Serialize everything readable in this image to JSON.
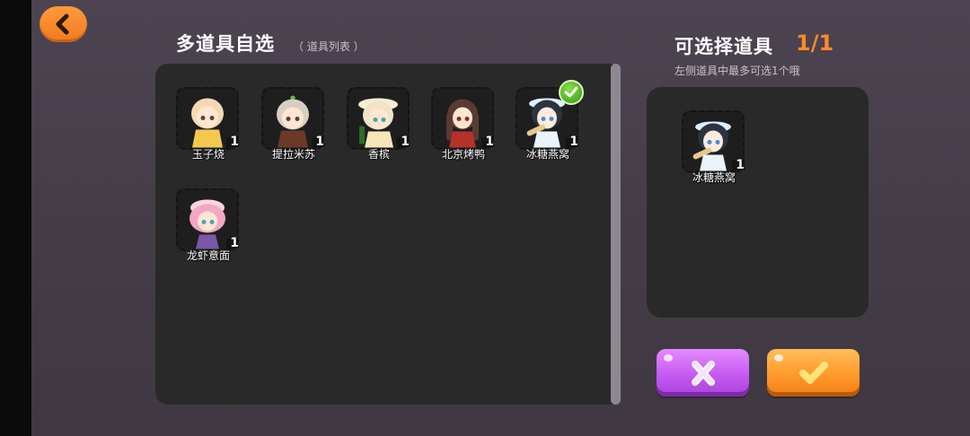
{
  "header": {
    "left_title": "多道具自选",
    "left_subtitle": "（ 道具列表 ）",
    "right_title": "可选择道具",
    "right_count": "1/1",
    "right_hint": "左侧道具中最多可选1个哦"
  },
  "items": [
    {
      "name": "玉子烧",
      "count": "1",
      "selected": false,
      "palette": {
        "hair": "#f3d9b3",
        "cloth": "#f2c94c"
      }
    },
    {
      "name": "提拉米苏",
      "count": "1",
      "selected": false,
      "palette": {
        "hair": "#d8cfc0",
        "cloth": "#6b3a28"
      }
    },
    {
      "name": "香槟",
      "count": "1",
      "selected": false,
      "palette": {
        "hair": "#f1e4c6",
        "cloth": "#f4e6b8"
      }
    },
    {
      "name": "北京烤鸭",
      "count": "1",
      "selected": false,
      "palette": {
        "hair": "#5a3b32",
        "cloth": "#b5322a"
      }
    },
    {
      "name": "冰糖燕窝",
      "count": "1",
      "selected": true,
      "palette": {
        "hair": "#2c3440",
        "cloth": "#e9f4fb"
      }
    },
    {
      "name": "龙虾意面",
      "count": "1",
      "selected": false,
      "palette": {
        "hair": "#f2a7c4",
        "cloth": "#7b57a8"
      }
    }
  ],
  "selected_items": [
    {
      "name": "冰糖燕窝",
      "count": "1",
      "palette": {
        "hair": "#2c3440",
        "cloth": "#e9f4fb"
      }
    }
  ],
  "colors": {
    "accent": "#ff8a2a",
    "cancel": "#c55af2",
    "confirm": "#ff9a2a",
    "check": "#4aae1f"
  }
}
